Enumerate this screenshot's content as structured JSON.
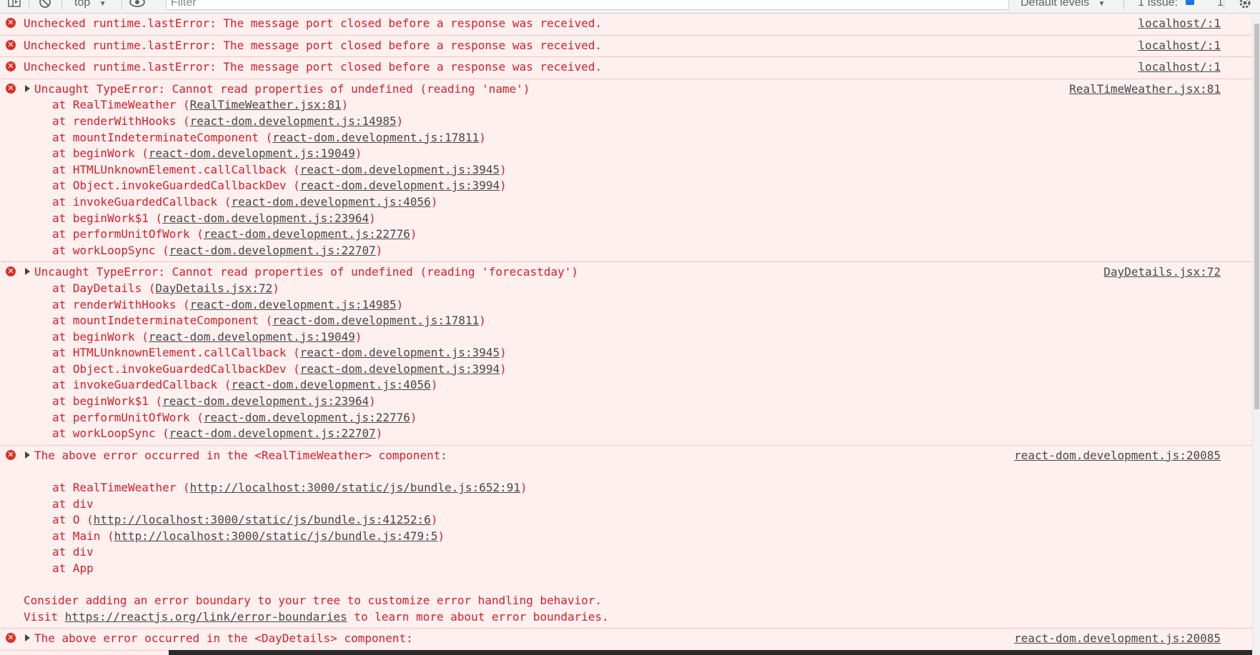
{
  "toolbar": {
    "context": "top",
    "filter_placeholder": "Filter",
    "levels_label": "Default levels",
    "issues_label": "1 Issue:",
    "issues_count": "1"
  },
  "messages": [
    {
      "type": "error",
      "source": "localhost/:1",
      "lines": [
        {
          "text": "Unchecked runtime.lastError: The message port closed before a response was received."
        }
      ]
    },
    {
      "type": "error",
      "source": "localhost/:1",
      "lines": [
        {
          "text": "Unchecked runtime.lastError: The message port closed before a response was received."
        }
      ]
    },
    {
      "type": "error",
      "source": "localhost/:1",
      "lines": [
        {
          "text": "Unchecked runtime.lastError: The message port closed before a response was received."
        }
      ]
    },
    {
      "type": "error",
      "expandable": true,
      "source": "RealTimeWeather.jsx:81",
      "lines": [
        {
          "text": "Uncaught TypeError: Cannot read properties of undefined (reading 'name')"
        },
        {
          "indent": true,
          "prefix": "at RealTimeWeather (",
          "link": "RealTimeWeather.jsx:81",
          "suffix": ")"
        },
        {
          "indent": true,
          "prefix": "at renderWithHooks (",
          "link": "react-dom.development.js:14985",
          "suffix": ")"
        },
        {
          "indent": true,
          "prefix": "at mountIndeterminateComponent (",
          "link": "react-dom.development.js:17811",
          "suffix": ")"
        },
        {
          "indent": true,
          "prefix": "at beginWork (",
          "link": "react-dom.development.js:19049",
          "suffix": ")"
        },
        {
          "indent": true,
          "prefix": "at HTMLUnknownElement.callCallback (",
          "link": "react-dom.development.js:3945",
          "suffix": ")"
        },
        {
          "indent": true,
          "prefix": "at Object.invokeGuardedCallbackDev (",
          "link": "react-dom.development.js:3994",
          "suffix": ")"
        },
        {
          "indent": true,
          "prefix": "at invokeGuardedCallback (",
          "link": "react-dom.development.js:4056",
          "suffix": ")"
        },
        {
          "indent": true,
          "prefix": "at beginWork$1 (",
          "link": "react-dom.development.js:23964",
          "suffix": ")"
        },
        {
          "indent": true,
          "prefix": "at performUnitOfWork (",
          "link": "react-dom.development.js:22776",
          "suffix": ")"
        },
        {
          "indent": true,
          "prefix": "at workLoopSync (",
          "link": "react-dom.development.js:22707",
          "suffix": ")"
        }
      ]
    },
    {
      "type": "error",
      "expandable": true,
      "source": "DayDetails.jsx:72",
      "lines": [
        {
          "text": "Uncaught TypeError: Cannot read properties of undefined (reading 'forecastday')"
        },
        {
          "indent": true,
          "prefix": "at DayDetails (",
          "link": "DayDetails.jsx:72",
          "suffix": ")"
        },
        {
          "indent": true,
          "prefix": "at renderWithHooks (",
          "link": "react-dom.development.js:14985",
          "suffix": ")"
        },
        {
          "indent": true,
          "prefix": "at mountIndeterminateComponent (",
          "link": "react-dom.development.js:17811",
          "suffix": ")"
        },
        {
          "indent": true,
          "prefix": "at beginWork (",
          "link": "react-dom.development.js:19049",
          "suffix": ")"
        },
        {
          "indent": true,
          "prefix": "at HTMLUnknownElement.callCallback (",
          "link": "react-dom.development.js:3945",
          "suffix": ")"
        },
        {
          "indent": true,
          "prefix": "at Object.invokeGuardedCallbackDev (",
          "link": "react-dom.development.js:3994",
          "suffix": ")"
        },
        {
          "indent": true,
          "prefix": "at invokeGuardedCallback (",
          "link": "react-dom.development.js:4056",
          "suffix": ")"
        },
        {
          "indent": true,
          "prefix": "at beginWork$1 (",
          "link": "react-dom.development.js:23964",
          "suffix": ")"
        },
        {
          "indent": true,
          "prefix": "at performUnitOfWork (",
          "link": "react-dom.development.js:22776",
          "suffix": ")"
        },
        {
          "indent": true,
          "prefix": "at workLoopSync (",
          "link": "react-dom.development.js:22707",
          "suffix": ")"
        }
      ]
    },
    {
      "type": "error",
      "expandable": true,
      "source": "react-dom.development.js:20085",
      "lines": [
        {
          "text": "The above error occurred in the <RealTimeWeather> component:"
        },
        {
          "blank": true
        },
        {
          "indent": true,
          "prefix": "at RealTimeWeather (",
          "link": "http://localhost:3000/static/js/bundle.js:652:91",
          "suffix": ")"
        },
        {
          "indent": true,
          "text": "at div"
        },
        {
          "indent": true,
          "prefix": "at O (",
          "link": "http://localhost:3000/static/js/bundle.js:41252:6",
          "suffix": ")"
        },
        {
          "indent": true,
          "prefix": "at Main (",
          "link": "http://localhost:3000/static/js/bundle.js:479:5",
          "suffix": ")"
        },
        {
          "indent": true,
          "text": "at div"
        },
        {
          "indent": true,
          "text": "at App"
        },
        {
          "blank": true
        },
        {
          "text": "Consider adding an error boundary to your tree to customize error handling behavior."
        },
        {
          "prefix": "Visit ",
          "link": "https://reactjs.org/link/error-boundaries",
          "suffix": " to learn more about error boundaries."
        }
      ]
    },
    {
      "type": "error",
      "expandable": true,
      "source": "react-dom.development.js:20085",
      "lines": [
        {
          "text": "The above error occurred in the <DayDetails> component:"
        }
      ]
    }
  ]
}
